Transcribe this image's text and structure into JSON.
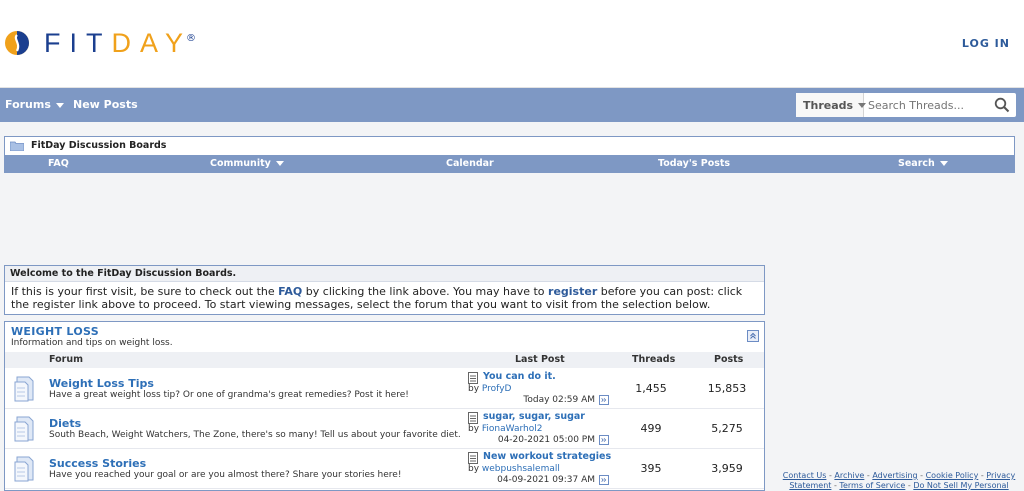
{
  "header": {
    "logo_fit": "FIT",
    "logo_day": "DAY",
    "logo_reg": "®",
    "login_label": "LOG IN",
    "brand_orange": "#f0a11b",
    "brand_blue": "#1b3f8f"
  },
  "navbar": {
    "forums_label": "Forums",
    "new_posts_label": "New Posts",
    "search_type_label": "Threads",
    "search_placeholder": "Search Threads...",
    "bar_color": "#7e98c4"
  },
  "board": {
    "title": "FitDay Discussion Boards",
    "links": {
      "faq": "FAQ",
      "community": "Community",
      "calendar": "Calendar",
      "todays_posts": "Today's Posts",
      "search": "Search"
    }
  },
  "welcome": {
    "title": "Welcome to the FitDay Discussion Boards.",
    "text_1": "If this is your first visit, be sure to check out the ",
    "faq_link": "FAQ",
    "text_2": " by clicking the link above. You may have to ",
    "register_link": "register",
    "text_3": " before you can post: click the register link above to proceed. To start viewing messages, select the forum that you want to visit from the selection below."
  },
  "category": {
    "title": "WEIGHT LOSS",
    "description": "Information and tips on weight loss.",
    "columns": {
      "forum": "Forum",
      "last_post": "Last Post",
      "threads": "Threads",
      "posts": "Posts"
    },
    "forums": [
      {
        "title": "Weight Loss Tips",
        "description": "Have a great weight loss tip? Or one of grandma's great remedies? Post it here!",
        "last_post_title": "You can do it.",
        "by_label": "by ",
        "last_post_user": "ProfyD",
        "last_post_date": "Today 02:59 AM",
        "threads": "1,455",
        "posts": "15,853"
      },
      {
        "title": "Diets",
        "description": "South Beach, Weight Watchers, The Zone, there's so many! Tell us about your favorite diet.",
        "last_post_title": "sugar, sugar, sugar",
        "by_label": "by ",
        "last_post_user": "FionaWarhol2",
        "last_post_date": "04-20-2021 05:00 PM",
        "threads": "499",
        "posts": "5,275"
      },
      {
        "title": "Success Stories",
        "description": "Have you reached your goal or are you almost there? Share your stories here!",
        "last_post_title": "New workout strategies",
        "by_label": "by ",
        "last_post_user": "webpushsalemall",
        "last_post_date": "04-09-2021 09:37 AM",
        "threads": "395",
        "posts": "3,959"
      }
    ]
  },
  "footer": {
    "contact": "Contact Us",
    "archive": "Archive",
    "advertising": "Advertising",
    "cookie": "Cookie Policy",
    "privacy": "Privacy Statement",
    "terms": "Terms of Service",
    "dnsmpi": "Do Not Sell My Personal",
    "sep": " - "
  }
}
